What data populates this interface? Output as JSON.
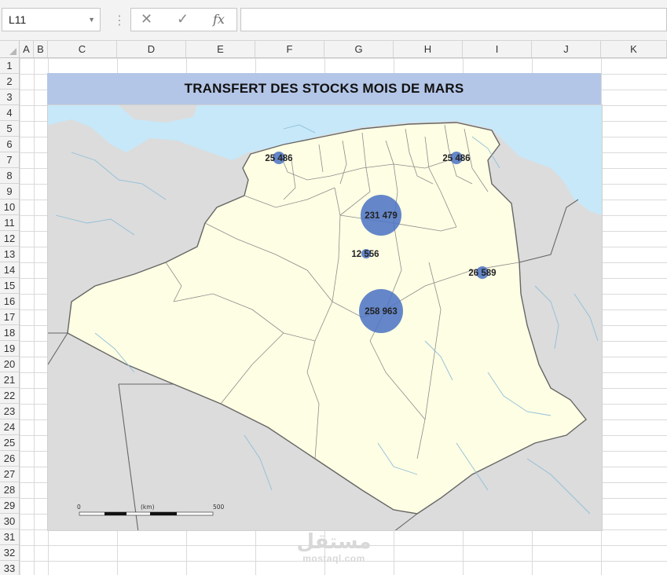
{
  "formula_bar": {
    "name_box": "L11",
    "cancel_glyph": "✕",
    "enter_glyph": "✓",
    "fx_label": "fx",
    "formula": ""
  },
  "columns": [
    "A",
    "B",
    "C",
    "D",
    "E",
    "F",
    "G",
    "H",
    "I",
    "J",
    "K"
  ],
  "rows": [
    "1",
    "2",
    "3",
    "4",
    "5",
    "6",
    "7",
    "8",
    "9",
    "10",
    "11",
    "12",
    "13",
    "14",
    "15",
    "16",
    "17",
    "18",
    "19",
    "20",
    "21",
    "22",
    "23",
    "24",
    "25",
    "26",
    "27",
    "28",
    "29",
    "30",
    "31",
    "32",
    "33"
  ],
  "chart": {
    "title": "TRANSFERT DES STOCKS MOIS DE MARS",
    "title_band_color": "#b4c6e7",
    "bubble_color": "#4a72c4",
    "sea_color": "#c6e8f9",
    "country_fill": "#fefee4",
    "neighbor_fill": "#dcdcdc",
    "bubbles": [
      {
        "label": "25 486",
        "value": 25486
      },
      {
        "label": "25 486",
        "value": 25486
      },
      {
        "label": "231 479",
        "value": 231479
      },
      {
        "label": "12 556",
        "value": 12556
      },
      {
        "label": "26 589",
        "value": 26589
      },
      {
        "label": "258 963",
        "value": 258963
      }
    ],
    "scale_bar": {
      "start": "0",
      "unit": "(km)",
      "end": "500"
    }
  },
  "watermark": {
    "arabic": "مستقل",
    "latin": "mostaql.com"
  }
}
